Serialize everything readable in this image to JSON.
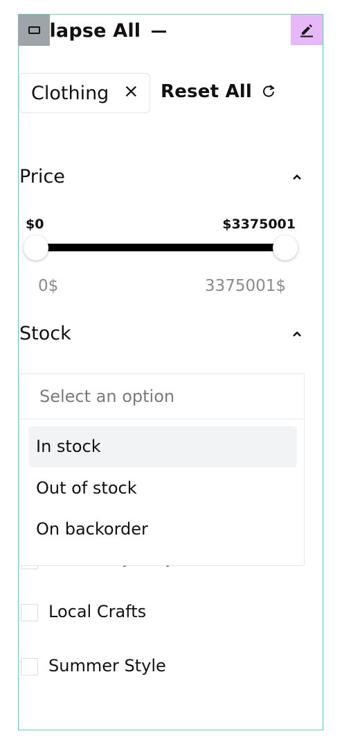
{
  "header": {
    "collapse_label": "llapse All",
    "toggle_icon": "window-icon",
    "edit_icon": "pencil-icon",
    "edit_color": "#e6b8f7"
  },
  "filters": {
    "active_chip": "Clothing",
    "chip_remove": "×",
    "reset_label": "Reset All"
  },
  "price": {
    "title": "Price",
    "min_label": "$0",
    "max_label": "$3375001",
    "range_min": "0$",
    "range_max": "3375001$",
    "slider_min_fraction": 0,
    "slider_max_fraction": 1
  },
  "stock": {
    "title": "Stock",
    "placeholder": "Select an option",
    "options": [
      "In stock",
      "Out of stock",
      "On backorder"
    ],
    "highlighted_option": "In stock"
  },
  "collections": {
    "partially_hidden_label": "Summer Jersey",
    "items": [
      "Local Crafts",
      "Summer Style"
    ]
  },
  "colors": {
    "frame_border": "#6ccfa9",
    "handle_gray": "#9fa3aa"
  }
}
